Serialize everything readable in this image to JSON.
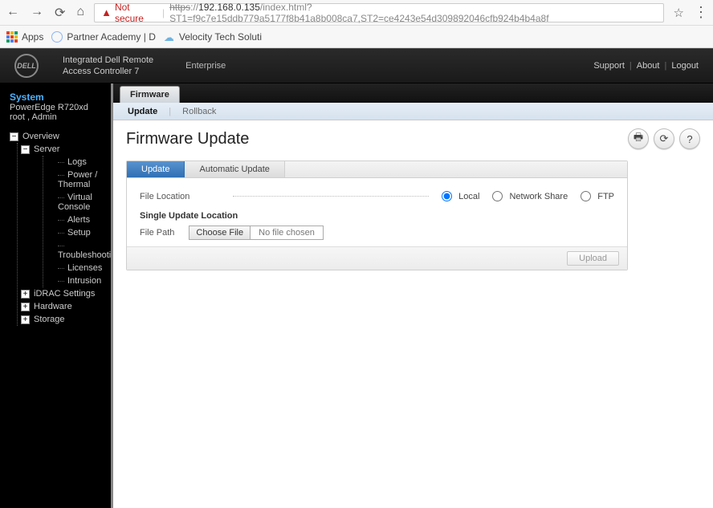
{
  "browser": {
    "not_secure_label": "Not secure",
    "url_scheme": "https",
    "url_host": "192.168.0.135",
    "url_path": "/index.html?ST1=f9c7e15ddb779a5177f8b41a8b008ca7,ST2=ce4243e54d309892046cfb924b4b4a8f"
  },
  "bookmarks": {
    "apps_label": "Apps",
    "items": [
      "Partner Academy | D",
      "Velocity Tech Soluti"
    ]
  },
  "header": {
    "logo_text": "DELL",
    "product_line1": "Integrated Dell Remote",
    "product_line2": "Access Controller 7",
    "edition": "Enterprise",
    "links": {
      "support": "Support",
      "about": "About",
      "logout": "Logout"
    }
  },
  "sidebar": {
    "title": "System",
    "model": "PowerEdge R720xd",
    "user": "root , Admin",
    "overview_label": "Overview",
    "server_label": "Server",
    "server_children": [
      "Logs",
      "Power / Thermal",
      "Virtual Console",
      "Alerts",
      "Setup",
      "Troubleshooting",
      "Licenses",
      "Intrusion"
    ],
    "root_children": [
      "iDRAC Settings",
      "Hardware",
      "Storage"
    ]
  },
  "tabs": {
    "level1": "Firmware",
    "level2": [
      "Update",
      "Rollback"
    ],
    "level2_active": 0
  },
  "page": {
    "title": "Firmware Update",
    "inner_tabs": [
      "Update",
      "Automatic Update"
    ],
    "file_location_label": "File Location",
    "radios": {
      "local": "Local",
      "network": "Network Share",
      "ftp": "FTP"
    },
    "section_title": "Single Update Location",
    "file_path_label": "File Path",
    "choose_file_label": "Choose File",
    "no_file_label": "No file chosen",
    "upload_label": "Upload"
  }
}
